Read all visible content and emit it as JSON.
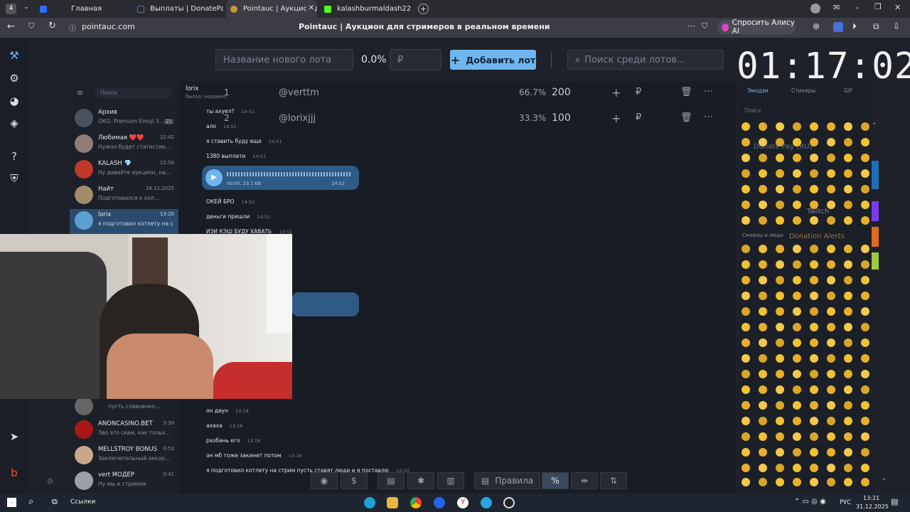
{
  "browser": {
    "tabs": [
      {
        "label": "Главная",
        "active": false,
        "color": "#2f6bff"
      },
      {
        "label": "Выплаты | DonatePay",
        "active": false,
        "color": "#1f2a3a"
      },
      {
        "label": "Pointauc | Аукцион для",
        "active": true,
        "color": "#c79a2f"
      },
      {
        "label": "kalashburmaldash228 Stre",
        "active": false,
        "color": "#53fc18"
      }
    ],
    "url": "pointauc.com",
    "page_title": "Pointauc | Аукцион для стримеров в реальном времени",
    "alice_label": "Спросить Алису AI"
  },
  "auction": {
    "new_lot_placeholder": "Название нового лота",
    "percent": "0.0%",
    "currency": "₽",
    "add_label": "Добавить лот",
    "search_placeholder": "Поиск среди лотов...",
    "timer": "01:17:02",
    "lots": [
      {
        "num": "1",
        "name": "@verttm",
        "percent": "66.7%",
        "amount": "200"
      },
      {
        "num": "2",
        "name": "@lorixjjj",
        "percent": "33.3%",
        "amount": "100"
      }
    ],
    "bottom": {
      "rules_label": "Правила",
      "percent_icon": "%"
    },
    "services": [
      "Donate Pay (RU)",
      "Twitch",
      "Donation Alerts"
    ]
  },
  "telegram": {
    "search_placeholder": "Поиск",
    "contact": "lorix",
    "status": "был(а) недавно",
    "chats": [
      {
        "name": "Архив",
        "preview": "ОКО. Premium Emoji З...",
        "time": "21",
        "avatar": "#4a5160"
      },
      {
        "name": "Любимая ❤️❤️",
        "preview": "Нужно будет статистик...",
        "time": "12:42",
        "avatar": "#8e7e75"
      },
      {
        "name": "KALASH 💎",
        "preview": "Ну давайте аукцион, на...",
        "time": "12:50",
        "avatar": "#c0392b"
      },
      {
        "name": "Найт",
        "preview": "Подготовился к хол...",
        "time": "18.12.2025",
        "avatar": "#a08c6a"
      },
      {
        "name": "lorix",
        "preview": "я подготовил котлету на ст...",
        "time": "13:20",
        "avatar": "#5d9fd0"
      },
      {
        "name": "",
        "preview": "пусть славненко...",
        "time": "",
        "avatar": "#666"
      },
      {
        "name": "ANONCASINO.BET",
        "preview": "Эво это скам, как тольк...",
        "time": "3:39",
        "avatar": "#a81818"
      },
      {
        "name": "MELLSTROY BONUS",
        "preview": "Заключительный аккор...",
        "time": "0:53",
        "avatar": "#c9a88a"
      },
      {
        "name": "vert МОДЕР",
        "preview": "Ну мы и стримом",
        "time": "0:41",
        "avatar": "#9aa0a6"
      }
    ],
    "messages_top": [
      {
        "text": "ты ахуел?",
        "time": "14:51"
      },
      {
        "text": "ало",
        "time": "14:51"
      },
      {
        "text": "я ставить буду еще",
        "time": "14:51"
      },
      {
        "text": "1380 выплати",
        "time": "14:51"
      },
      {
        "text": "ОКЕЙ БРО",
        "time": "14:52"
      },
      {
        "text": "деньги пришли",
        "time": "14:52"
      },
      {
        "text": "ИЗИ КЭШ БУДУ ХАВАТЬ",
        "time": "14:52"
      }
    ],
    "voice": {
      "duration": "00:05, 23.1 KB",
      "time": "14:52"
    },
    "messages_bottom": [
      {
        "text": "он даун",
        "time": "13:18"
      },
      {
        "text": "ахаха",
        "time": "13:18"
      },
      {
        "text": "разбань его",
        "time": "13:18"
      },
      {
        "text": "он мб тоже закинет потом",
        "time": "13:18"
      },
      {
        "text": "я подготовил котлету на стрим пусть ставят люди и я поставлю",
        "time": "13:20"
      }
    ],
    "emoji_tabs": [
      "Эмодзи",
      "Стикеры",
      "GIF"
    ],
    "emoji_search": "Поиск",
    "emoji_section": "Смайлы и люди"
  },
  "taskbar": {
    "search": "Ссылки",
    "lang": "РУС",
    "time": "13:21",
    "date": "31.12.2025"
  }
}
